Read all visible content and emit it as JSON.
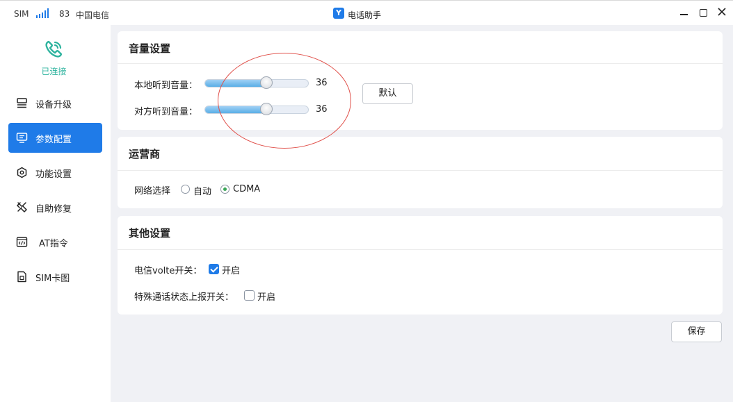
{
  "status": {
    "sim_label": "SIM",
    "signal_value": "83",
    "carrier": "中国电信"
  },
  "window": {
    "app_icon": "Y",
    "title": "电话助手"
  },
  "sidebar": {
    "connection": {
      "icon": "phone-icon",
      "status": "已连接",
      "color": "#2db39e"
    },
    "items": [
      {
        "label": "设备升级",
        "icon": "device-upgrade-icon",
        "active": false
      },
      {
        "label": "参数配置",
        "icon": "monitor-icon",
        "active": true
      },
      {
        "label": "功能设置",
        "icon": "gear-icon",
        "active": false
      },
      {
        "label": "自助修复",
        "icon": "wrench-icon",
        "active": false
      },
      {
        "label": "AT指令",
        "icon": "code-icon",
        "active": false
      },
      {
        "label": "SIM卡图",
        "icon": "sim-card-icon",
        "active": false
      }
    ]
  },
  "volume": {
    "title": "音量设置",
    "local_label": "本地听到音量：",
    "local_value": "36",
    "remote_label": "对方听到音量：",
    "remote_value": "36",
    "default_button": "默认",
    "slider_fraction": 0.59
  },
  "carrier_card": {
    "title": "运营商",
    "network_label": "网络选择",
    "options": [
      {
        "label": "自动",
        "checked": false
      },
      {
        "label": "CDMA",
        "checked": true
      }
    ]
  },
  "other": {
    "title": "其他设置",
    "volte_label": "电信volte开关：",
    "volte_option": "开启",
    "volte_checked": true,
    "report_label": "特殊通话状态上报开关：",
    "report_option": "开启",
    "report_checked": false
  },
  "save_button": "保存",
  "colors": {
    "accent": "#1f7be8",
    "connected": "#2db39e",
    "annotation": "#e0504a"
  }
}
